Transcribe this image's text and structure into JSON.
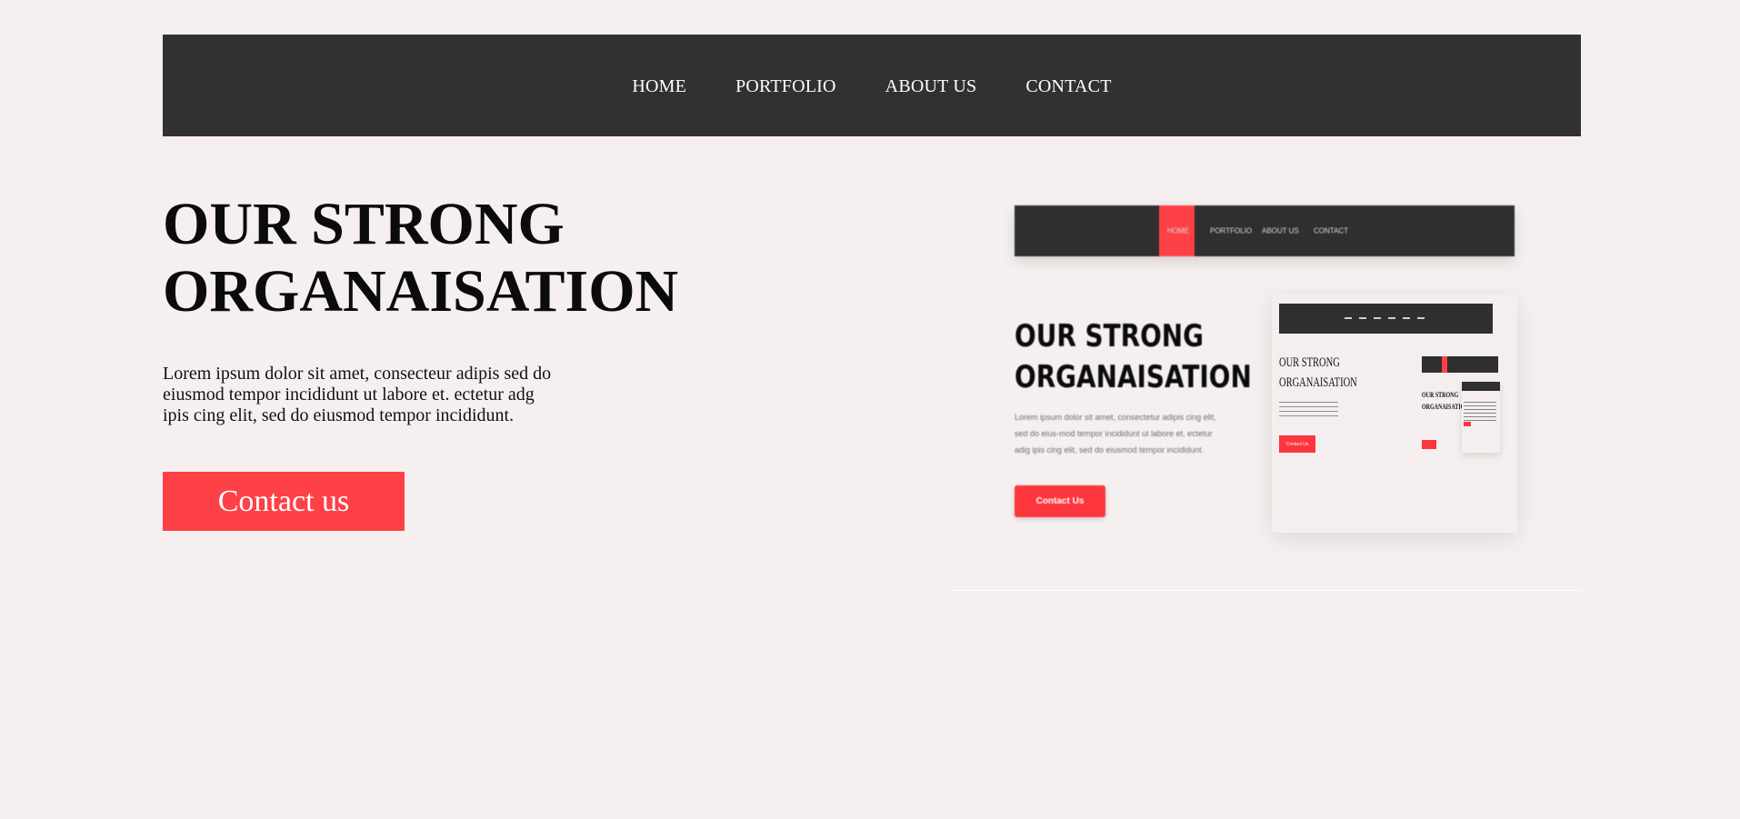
{
  "nav": {
    "items": [
      {
        "label": "HOME"
      },
      {
        "label": "PORTFOLIO"
      },
      {
        "label": "ABOUT US"
      },
      {
        "label": "CONTACT"
      }
    ]
  },
  "hero": {
    "title_line1": "OUR STRONG",
    "title_line2": "ORGANAISATION",
    "text": "Lorem ipsum dolor sit amet, consecteur adipis sed do eiusmod tempor incididunt ut labore et. ectetur adg ipis cing elit, sed do eiusmod tempor incididunt.",
    "cta_label": "Contact us"
  },
  "preview": {
    "nav_items": [
      {
        "label": "HOME"
      },
      {
        "label": "PORTFOLIO"
      },
      {
        "label": "ABOUT US"
      },
      {
        "label": "CONTACT"
      }
    ],
    "title_line1": "OUR STRONG",
    "title_line2": "ORGANAISATION",
    "text": "Lorem ipsum dolor sit amet, consectetur adipis cing elit, sed do eius-mod tempor incididunt  ut labore et. ectetur adig ipis cing elit, sed do eiusmod tempor incididunt.",
    "cta_label": "Contact Us",
    "card": {
      "title_line1": "OUR STRONG",
      "title_line2": "ORGANAISATION",
      "cta_label": "Contact Us",
      "mini_title_line1": "OUR STRONG",
      "mini_title_line2": "ORGANAISATION"
    }
  },
  "colors": {
    "background": "#f5f0ef",
    "navbar": "#313131",
    "accent": "#fd4147",
    "text": "#0b0b0b"
  }
}
